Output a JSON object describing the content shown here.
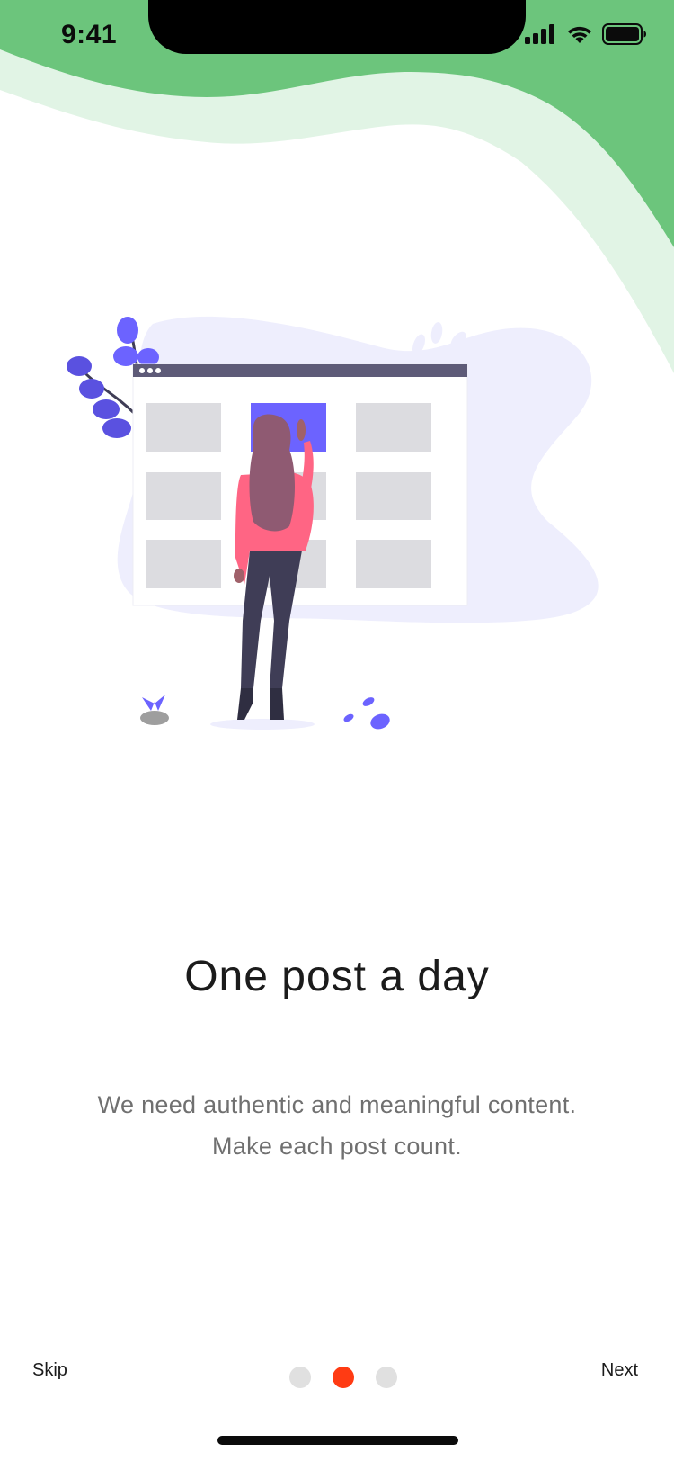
{
  "status_bar": {
    "time": "9:41"
  },
  "onboarding": {
    "title": "One post a day",
    "description_line1": "We need authentic and meaningful content.",
    "description_line2": "Make each post count."
  },
  "navigation": {
    "skip_label": "Skip",
    "next_label": "Next",
    "page_count": 3,
    "current_page": 2
  },
  "colors": {
    "header_green": "#6CC57C",
    "header_green_light": "#E1F4E5",
    "accent_purple": "#6C63FF",
    "active_dot": "#FF3B13",
    "inactive_dot": "#E0E0E0"
  },
  "icons": [
    "cellular-signal-icon",
    "wifi-icon",
    "battery-icon"
  ]
}
